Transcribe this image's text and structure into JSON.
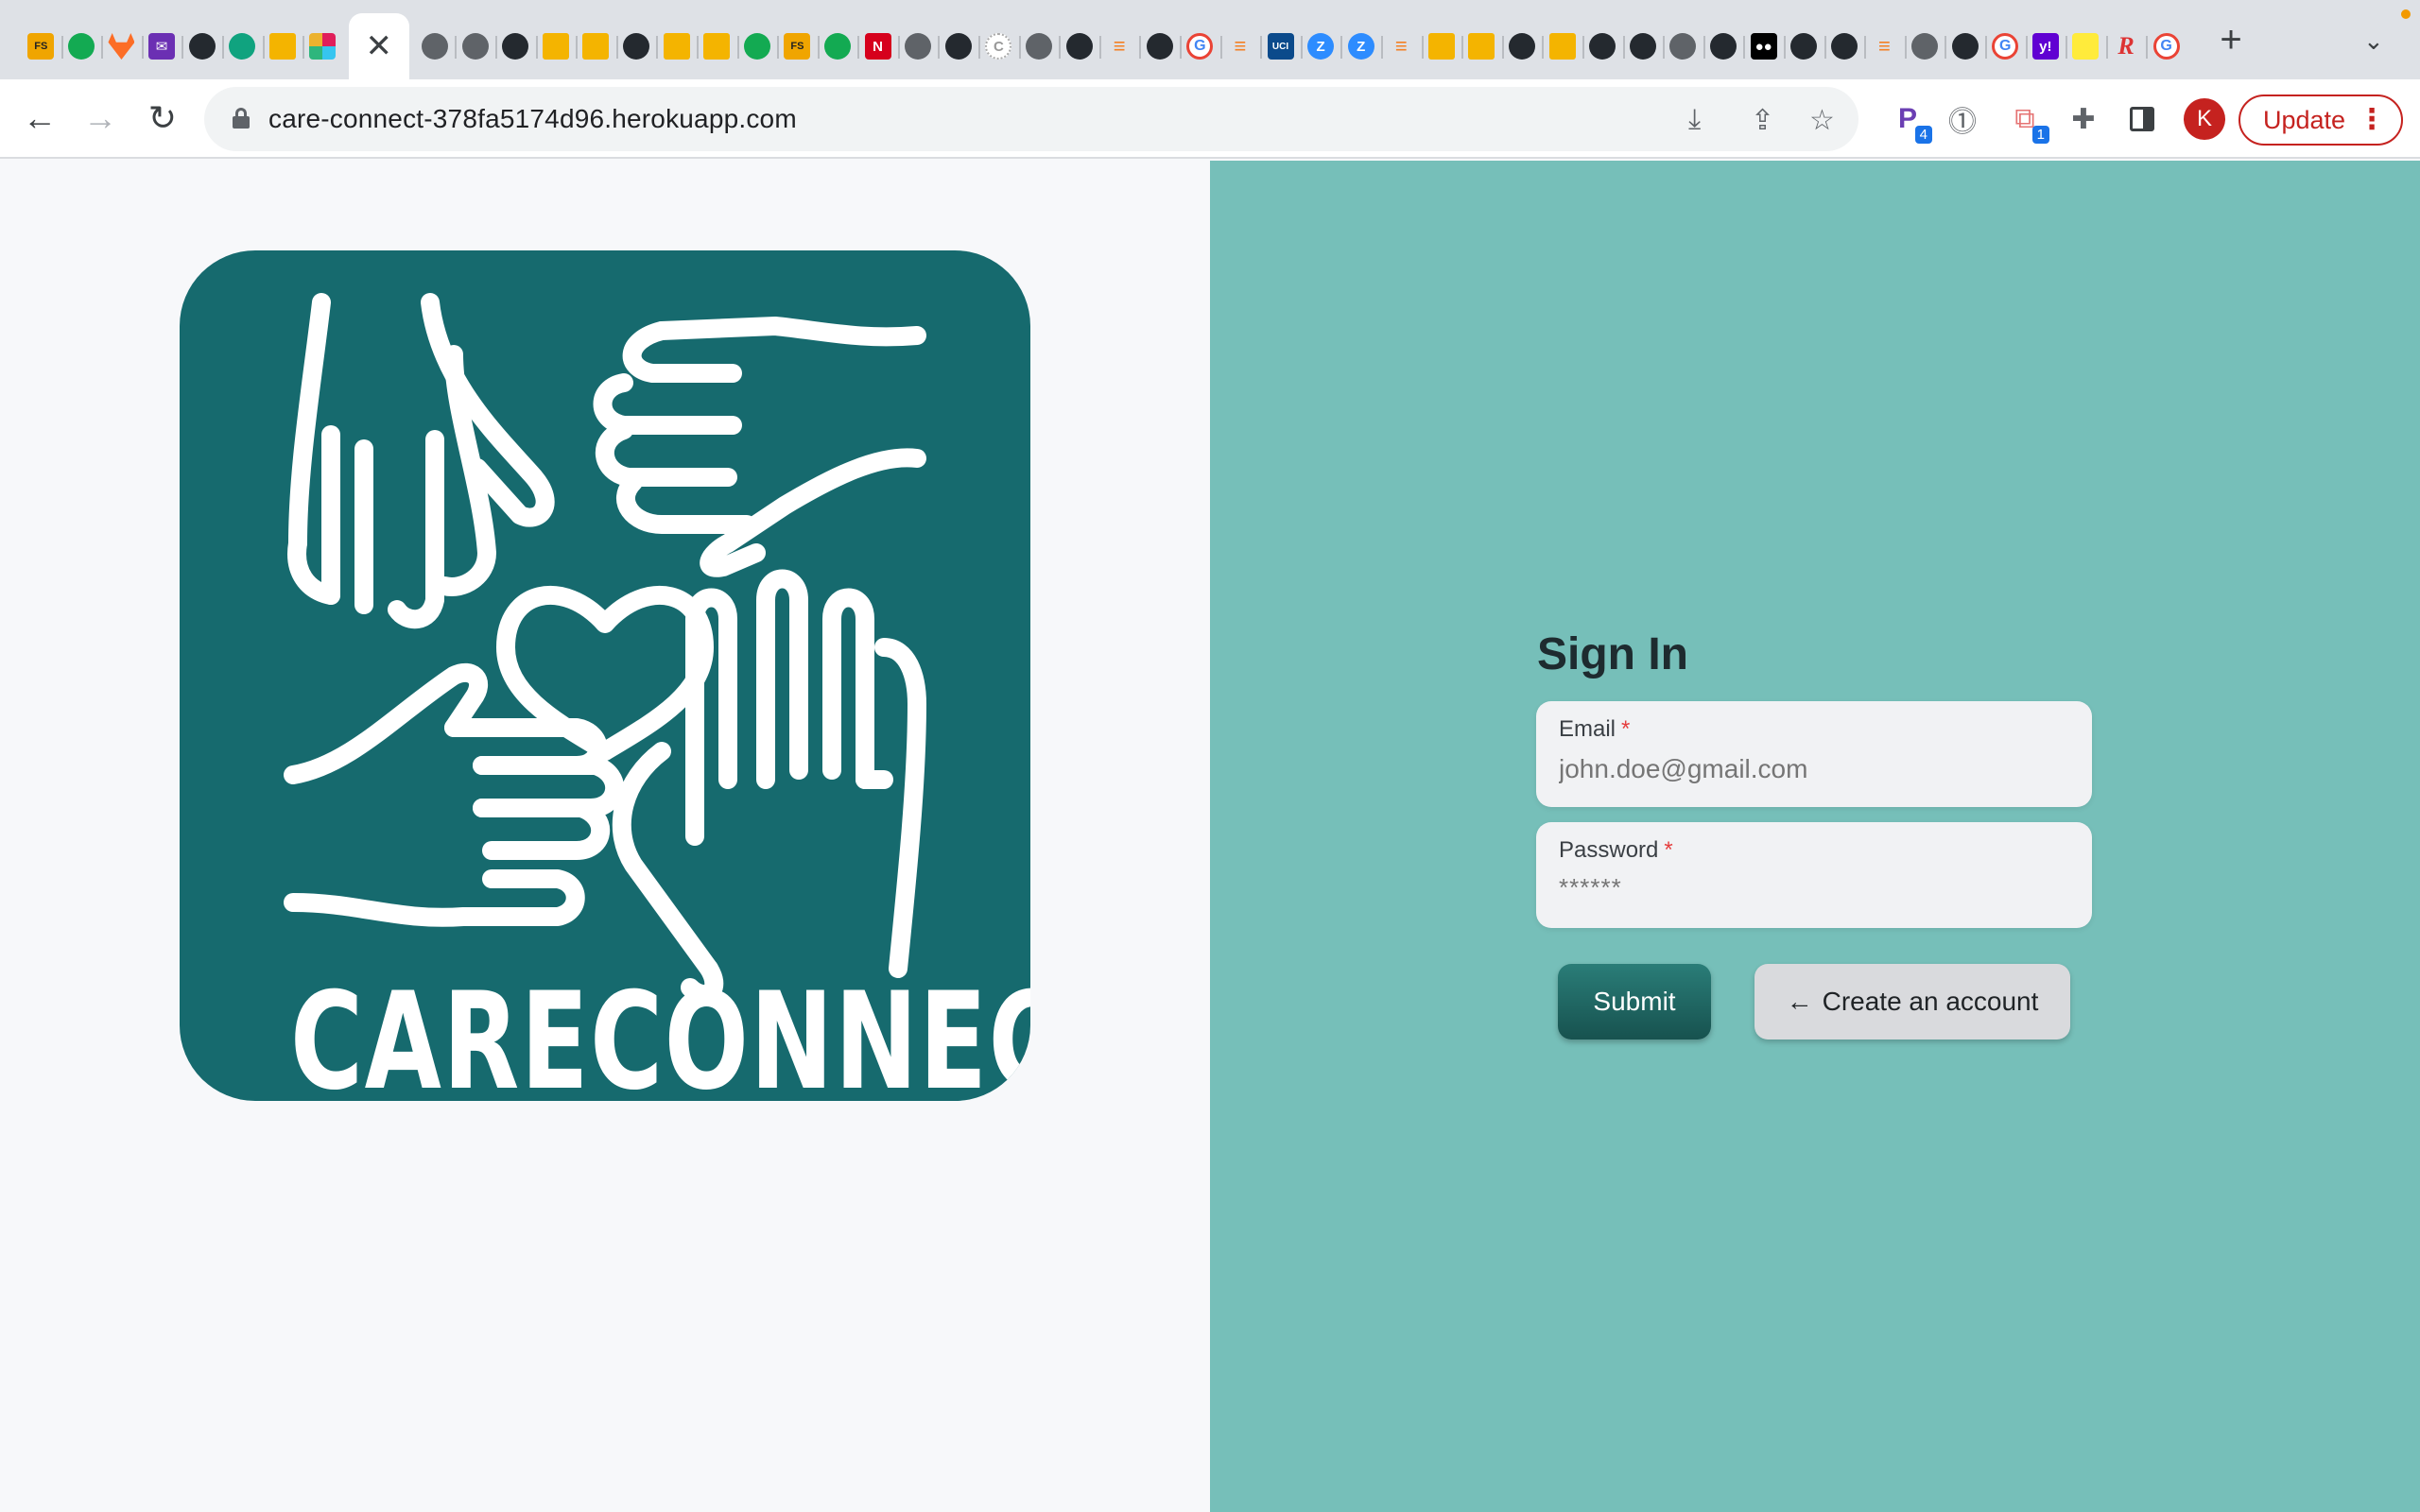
{
  "browser": {
    "tabs": [
      {
        "icon": "fs-icon",
        "kind": "fs",
        "glyph": "FS"
      },
      {
        "icon": "mongodb-icon",
        "kind": "mongo",
        "glyph": ""
      },
      {
        "icon": "gitlab-icon",
        "kind": "gitlab",
        "glyph": ""
      },
      {
        "icon": "mail-icon",
        "kind": "mail",
        "glyph": "✉"
      },
      {
        "icon": "github-icon",
        "kind": "gh",
        "glyph": ""
      },
      {
        "icon": "openai-icon",
        "kind": "gpt",
        "glyph": ""
      },
      {
        "icon": "slides-icon",
        "kind": "slides",
        "glyph": ""
      },
      {
        "icon": "slack-icon",
        "kind": "slack",
        "glyph": ""
      },
      {
        "icon": "close-icon",
        "kind": "active",
        "glyph": "✕"
      },
      {
        "icon": "globe-icon",
        "kind": "globe",
        "glyph": ""
      },
      {
        "icon": "globe-icon",
        "kind": "globe",
        "glyph": ""
      },
      {
        "icon": "github-icon",
        "kind": "gh",
        "glyph": ""
      },
      {
        "icon": "slides-icon",
        "kind": "slides",
        "glyph": ""
      },
      {
        "icon": "slides-icon",
        "kind": "slides",
        "glyph": ""
      },
      {
        "icon": "github-icon",
        "kind": "gh",
        "glyph": ""
      },
      {
        "icon": "slides-icon",
        "kind": "slides",
        "glyph": ""
      },
      {
        "icon": "slides-icon",
        "kind": "slides",
        "glyph": ""
      },
      {
        "icon": "mongodb-icon",
        "kind": "mongo",
        "glyph": ""
      },
      {
        "icon": "fs-icon",
        "kind": "fs",
        "glyph": "FS"
      },
      {
        "icon": "mongodb-icon",
        "kind": "mongo",
        "glyph": ""
      },
      {
        "icon": "netflix-icon",
        "kind": "netflix",
        "glyph": "N"
      },
      {
        "icon": "globe-icon",
        "kind": "globe",
        "glyph": ""
      },
      {
        "icon": "github-icon",
        "kind": "gh",
        "glyph": ""
      },
      {
        "icon": "c-icon",
        "kind": "c",
        "glyph": "C"
      },
      {
        "icon": "globe-icon",
        "kind": "globe",
        "glyph": ""
      },
      {
        "icon": "github-icon",
        "kind": "gh",
        "glyph": ""
      },
      {
        "icon": "stackoverflow-icon",
        "kind": "so",
        "glyph": "≡"
      },
      {
        "icon": "github-icon",
        "kind": "gh",
        "glyph": ""
      },
      {
        "icon": "google-icon",
        "kind": "google",
        "glyph": "G"
      },
      {
        "icon": "stackoverflow-icon",
        "kind": "so",
        "glyph": "≡"
      },
      {
        "icon": "uci-icon",
        "kind": "uci",
        "glyph": "UCI"
      },
      {
        "icon": "zoom-icon",
        "kind": "zoom",
        "glyph": "Z"
      },
      {
        "icon": "zoom-icon",
        "kind": "zoom",
        "glyph": "Z"
      },
      {
        "icon": "stackoverflow-icon",
        "kind": "so",
        "glyph": "≡"
      },
      {
        "icon": "slides-icon",
        "kind": "slides",
        "glyph": ""
      },
      {
        "icon": "slides-icon",
        "kind": "slides",
        "glyph": ""
      },
      {
        "icon": "github-icon",
        "kind": "gh",
        "glyph": ""
      },
      {
        "icon": "slides-icon",
        "kind": "slides",
        "glyph": ""
      },
      {
        "icon": "github-icon",
        "kind": "gh",
        "glyph": ""
      },
      {
        "icon": "github-icon",
        "kind": "gh",
        "glyph": ""
      },
      {
        "icon": "globe-icon",
        "kind": "globe",
        "glyph": ""
      },
      {
        "icon": "github-icon",
        "kind": "gh",
        "glyph": ""
      },
      {
        "icon": "medium-icon",
        "kind": "medium",
        "glyph": "●●"
      },
      {
        "icon": "github-icon",
        "kind": "gh",
        "glyph": ""
      },
      {
        "icon": "github-icon",
        "kind": "gh",
        "glyph": ""
      },
      {
        "icon": "stackoverflow-icon",
        "kind": "so",
        "glyph": "≡"
      },
      {
        "icon": "globe-icon",
        "kind": "globe",
        "glyph": ""
      },
      {
        "icon": "github-icon",
        "kind": "gh",
        "glyph": ""
      },
      {
        "icon": "google-icon",
        "kind": "google",
        "glyph": "G"
      },
      {
        "icon": "yahoo-icon",
        "kind": "yahoo",
        "glyph": "y!"
      },
      {
        "icon": "note-icon",
        "kind": "note",
        "glyph": ""
      },
      {
        "icon": "r-icon",
        "kind": "r",
        "glyph": "R"
      },
      {
        "icon": "google-icon",
        "kind": "google",
        "glyph": "G"
      }
    ],
    "new_tab_glyph": "+",
    "tab_list_glyph": "⌄",
    "url": "care-connect-378fa5174d96.herokuapp.com",
    "back_glyph": "←",
    "forward_glyph": "→",
    "reload_glyph": "↻",
    "install_glyph": "⤓",
    "share_glyph": "⇪",
    "bookmark_glyph": "☆",
    "ext_pushbullet_badge": "4",
    "ext_third_badge": "1",
    "avatar_initial": "K",
    "update_label": "Update",
    "kebab_glyph": "⋮"
  },
  "brand": {
    "logo_word": "CARECONNECT",
    "tile_color": "#166a6e",
    "panel_color": "#76bfb9",
    "accent_submit": "#17524f"
  },
  "signin": {
    "title": "Sign In",
    "email_label": "Email",
    "email_placeholder": "john.doe@gmail.com",
    "password_label": "Password",
    "password_placeholder": "******",
    "required_mark": "*",
    "submit_label": "Submit",
    "create_arrow": "←",
    "create_label": "Create an account"
  }
}
